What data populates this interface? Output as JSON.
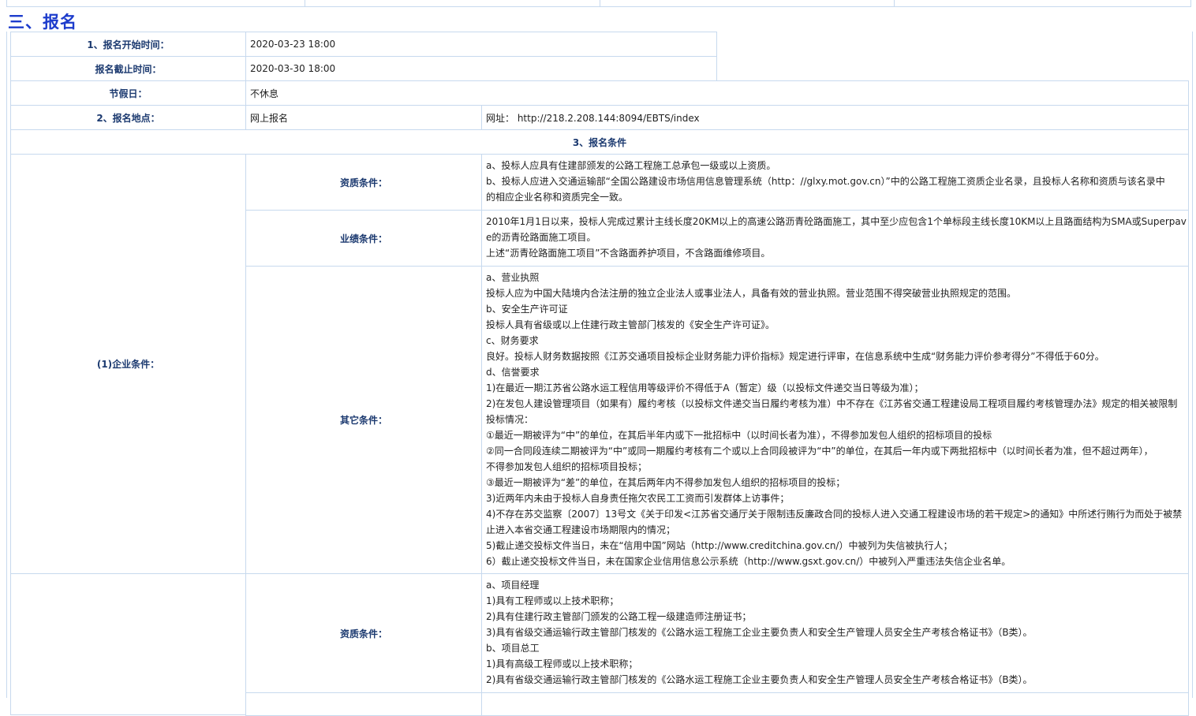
{
  "section_title": "三、报名",
  "rows": {
    "start_time": {
      "label": "1、报名开始时间：",
      "value": "2020-03-23 18:00"
    },
    "end_time": {
      "label": "报名截止时间：",
      "value": "2020-03-30 18:00"
    },
    "holiday": {
      "label": "节假日：",
      "value": "不休息"
    },
    "location": {
      "label": "2、报名地点：",
      "value": "网上报名",
      "url_label": "网址： http://218.2.208.144:8094/EBTS/index"
    },
    "conditions_header": "3、报名条件"
  },
  "enterprise": {
    "label": "(1)企业条件：",
    "qualification": {
      "label": "资质条件：",
      "lines": [
        "a、投标人应具有住建部颁发的公路工程施工总承包一级或以上资质。",
        "b、投标人应进入交通运输部“全国公路建设市场信用信息管理系统（http：//glxy.mot.gov.cn）”中的公路工程施工资质企业名录，且投标人名称和资质与该名录中",
        "的相应企业名称和资质完全一致。"
      ]
    },
    "performance": {
      "label": "业绩条件：",
      "lines": [
        "2010年1月1日以来，投标人完成过累计主线长度20KM以上的高速公路沥青砼路面施工，其中至少应包含1个单标段主线长度10KM以上且路面结构为SMA或Superpav",
        "e的沥青砼路面施工项目。",
        "上述“沥青砼路面施工项目”不含路面养护项目，不含路面维修项目。"
      ]
    },
    "other": {
      "label": "其它条件：",
      "lines": [
        "a、营业执照",
        "投标人应为中国大陆境内合法注册的独立企业法人或事业法人，具备有效的营业执照。营业范围不得突破营业执照规定的范围。",
        "b、安全生产许可证",
        "投标人具有省级或以上住建行政主管部门核发的《安全生产许可证》。",
        "c、财务要求",
        "良好。投标人财务数据按照《江苏交通项目投标企业财务能力评价指标》规定进行评审，在信息系统中生成“财务能力评价参考得分”不得低于60分。",
        "d、信誉要求",
        "1)在最近一期江苏省公路水运工程信用等级评价不得低于A（暂定）级（以投标文件递交当日等级为准）；",
        "2)在发包人建设管理项目（如果有）履约考核（以投标文件递交当日履约考核为准）中不存在《江苏省交通工程建设局工程项目履约考核管理办法》规定的相关被限制",
        "投标情况：",
        "①最近一期被评为“中”的单位，在其后半年内或下一批招标中（以时间长者为准），不得参加发包人组织的招标项目的投标",
        "②同一合同段连续二期被评为“中”或同一期履约考核有二个或以上合同段被评为“中”的单位，在其后一年内或下两批招标中（以时间长者为准，但不超过两年），",
        "不得参加发包人组织的招标项目投标；",
        "③最近一期被评为“差”的单位，在其后两年内不得参加发包人组织的招标项目的投标；",
        "3)近两年内未由于投标人自身责任拖欠农民工工资而引发群体上访事件；",
        "4)不存在苏交监察〔2007〕13号文《关于印发<江苏省交通厅关于限制违反廉政合同的投标人进入交通工程建设市场的若干规定>的通知》中所述行贿行为而处于被禁",
        "止进入本省交通工程建设市场期限内的情况；",
        "5)截止递交投标文件当日，未在“信用中国”网站（http://www.creditchina.gov.cn/）中被列为失信被执行人；",
        "6）截止递交投标文件当日，未在国家企业信用信息公示系统（http://www.gsxt.gov.cn/）中被列入严重违法失信企业名单。"
      ]
    }
  },
  "personnel": {
    "qualification": {
      "label": "资质条件：",
      "lines": [
        "a、项目经理",
        "1)具有工程师或以上技术职称；",
        "2)具有住建行政主管部门颁发的公路工程一级建造师注册证书；",
        "3)具有省级交通运输行政主管部门核发的《公路水运工程施工企业主要负责人和安全生产管理人员安全生产考核合格证书》（B类）。",
        "b、项目总工",
        "1)具有高级工程师或以上技术职称；",
        "2)具有省级交通运输行政主管部门核发的《公路水运工程施工企业主要负责人和安全生产管理人员安全生产考核合格证书》（B类）。"
      ]
    }
  }
}
